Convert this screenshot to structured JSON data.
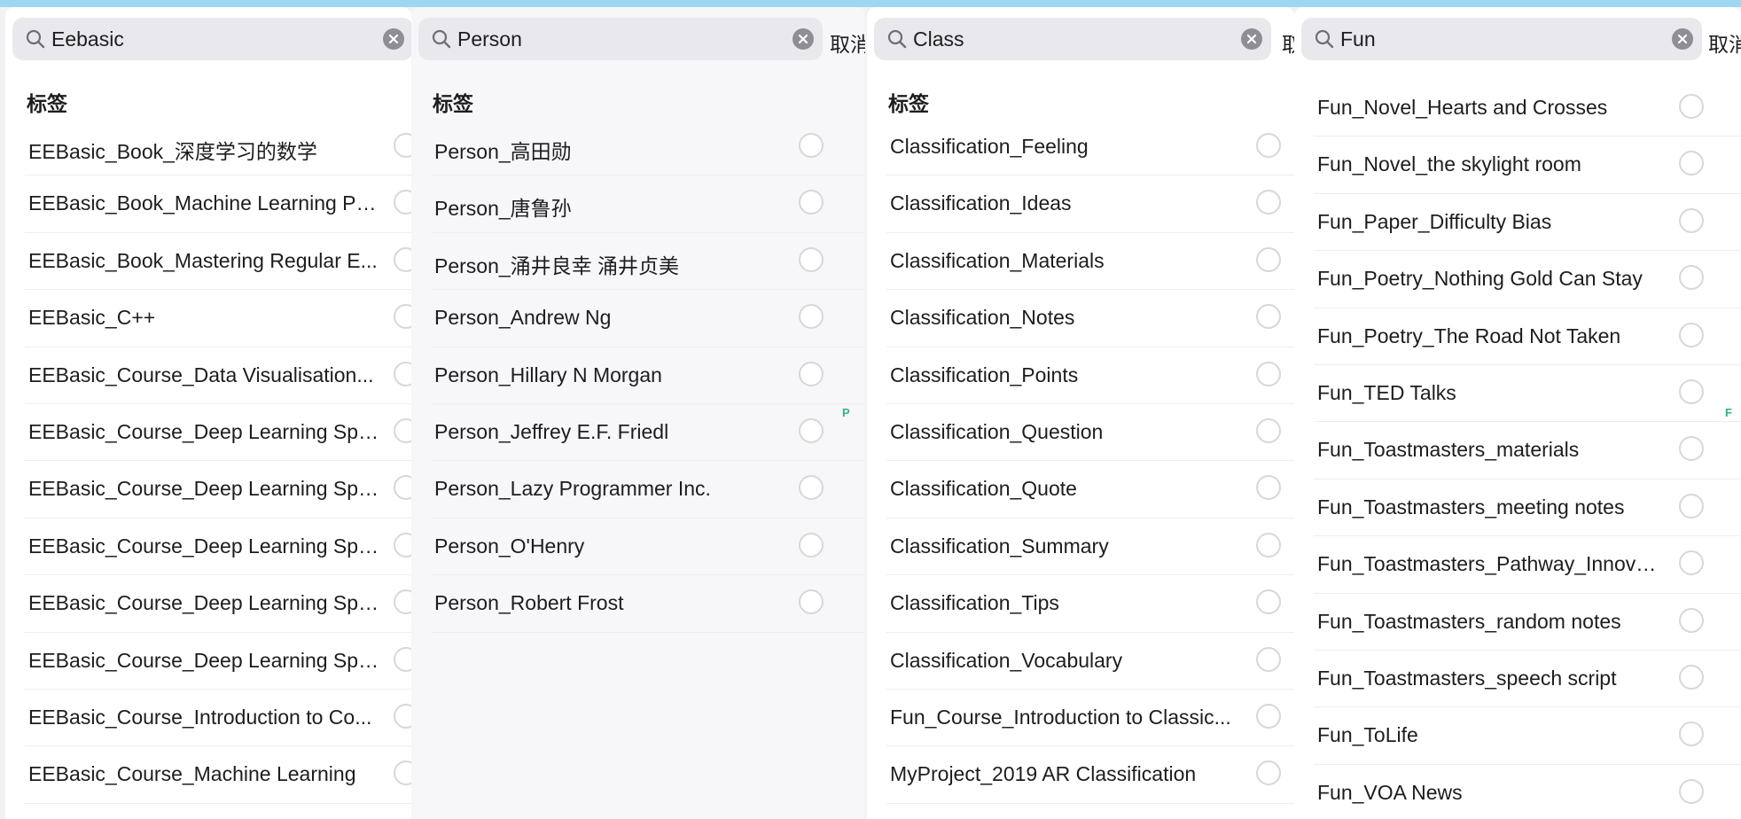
{
  "colors": {
    "background": "#f2f2f4",
    "panel": "#ffffff",
    "search_field": "#e9e9ed",
    "radio_border": "#d7d7dc",
    "separator": "#eeeeef",
    "index_letter": "#34b27b"
  },
  "icons": {
    "search": "magnifying-glass-icon",
    "clear": "clear-x-circle-icon",
    "radio": "radio-circle-unchecked"
  },
  "panels": [
    {
      "search_value": "Eebasic",
      "cancel_label": "",
      "section_header": "标签",
      "side_letter": "",
      "items": [
        "EEBasic_Book_深度学习的数学",
        "EEBasic_Book_Machine Learning Pa...",
        "EEBasic_Book_Mastering Regular E...",
        "EEBasic_C++",
        "EEBasic_Course_Data Visualisation...",
        "EEBasic_Course_Deep Learning Spe...",
        "EEBasic_Course_Deep Learning Spe...",
        "EEBasic_Course_Deep Learning Spe...",
        "EEBasic_Course_Deep Learning Spe...",
        "EEBasic_Course_Deep Learning Spe...",
        "EEBasic_Course_Introduction to Co...",
        "EEBasic_Course_Machine Learning"
      ]
    },
    {
      "search_value": "Person",
      "cancel_label": "取消",
      "section_header": "标签",
      "side_letter": "P",
      "items": [
        "Person_高田勋",
        "Person_唐鲁孙",
        "Person_涌井良幸 涌井贞美",
        "Person_Andrew Ng",
        "Person_Hillary N Morgan",
        "Person_Jeffrey E.F. Friedl",
        "Person_Lazy Programmer Inc.",
        "Person_O'Henry",
        "Person_Robert Frost"
      ]
    },
    {
      "search_value": "Class",
      "cancel_label": "取",
      "section_header": "标签",
      "side_letter": "",
      "items": [
        "Classification_Feeling",
        "Classification_Ideas",
        "Classification_Materials",
        "Classification_Notes",
        "Classification_Points",
        "Classification_Question",
        "Classification_Quote",
        "Classification_Summary",
        "Classification_Tips",
        "Classification_Vocabulary",
        "Fun_Course_Introduction to Classic...",
        "MyProject_2019 AR Classification"
      ]
    },
    {
      "search_value": "Fun",
      "cancel_label": "取消",
      "section_header": "",
      "side_letter": "F",
      "items": [
        "Fun_Novel_Hearts and Crosses",
        "Fun_Novel_the skylight room",
        "Fun_Paper_Difficulty Bias",
        "Fun_Poetry_Nothing Gold Can Stay",
        "Fun_Poetry_The Road Not Taken",
        "Fun_TED Talks",
        "Fun_Toastmasters_materials",
        "Fun_Toastmasters_meeting notes",
        "Fun_Toastmasters_Pathway_Innovat...",
        "Fun_Toastmasters_random notes",
        "Fun_Toastmasters_speech script",
        "Fun_ToLife",
        "Fun_VOA News"
      ]
    }
  ]
}
